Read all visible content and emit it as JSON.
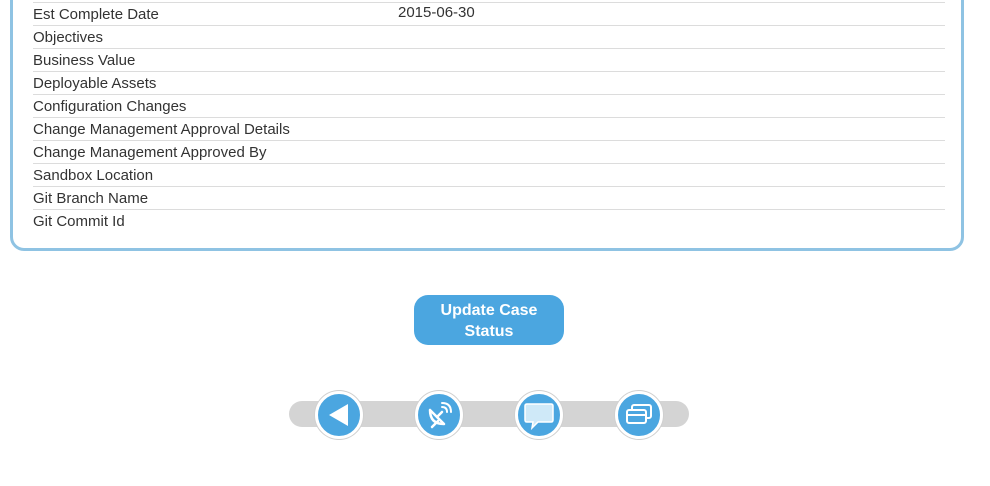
{
  "details": {
    "rows": [
      {
        "label": "Est Complete Date",
        "value": "2015-06-30"
      },
      {
        "label": "Objectives",
        "value": ""
      },
      {
        "label": "Business Value",
        "value": ""
      },
      {
        "label": "Deployable Assets",
        "value": ""
      },
      {
        "label": "Configuration Changes",
        "value": ""
      },
      {
        "label": "Change Management Approval Details",
        "value": ""
      },
      {
        "label": "Change Management Approved By",
        "value": ""
      },
      {
        "label": "Sandbox Location",
        "value": ""
      },
      {
        "label": "Git Branch Name",
        "value": ""
      },
      {
        "label": "Git Commit Id",
        "value": ""
      }
    ]
  },
  "actions": {
    "update_line1": "Update Case",
    "update_line2": "Status"
  },
  "toolbar": {
    "buttons": [
      {
        "icon": "back-arrow-icon"
      },
      {
        "icon": "satellite-dish-icon"
      },
      {
        "icon": "chat-bubble-icon"
      },
      {
        "icon": "cards-icon"
      }
    ]
  },
  "colors": {
    "accent": "#4ba6e0",
    "panel_border": "#8fc3e3",
    "track": "#d4d4d4"
  }
}
